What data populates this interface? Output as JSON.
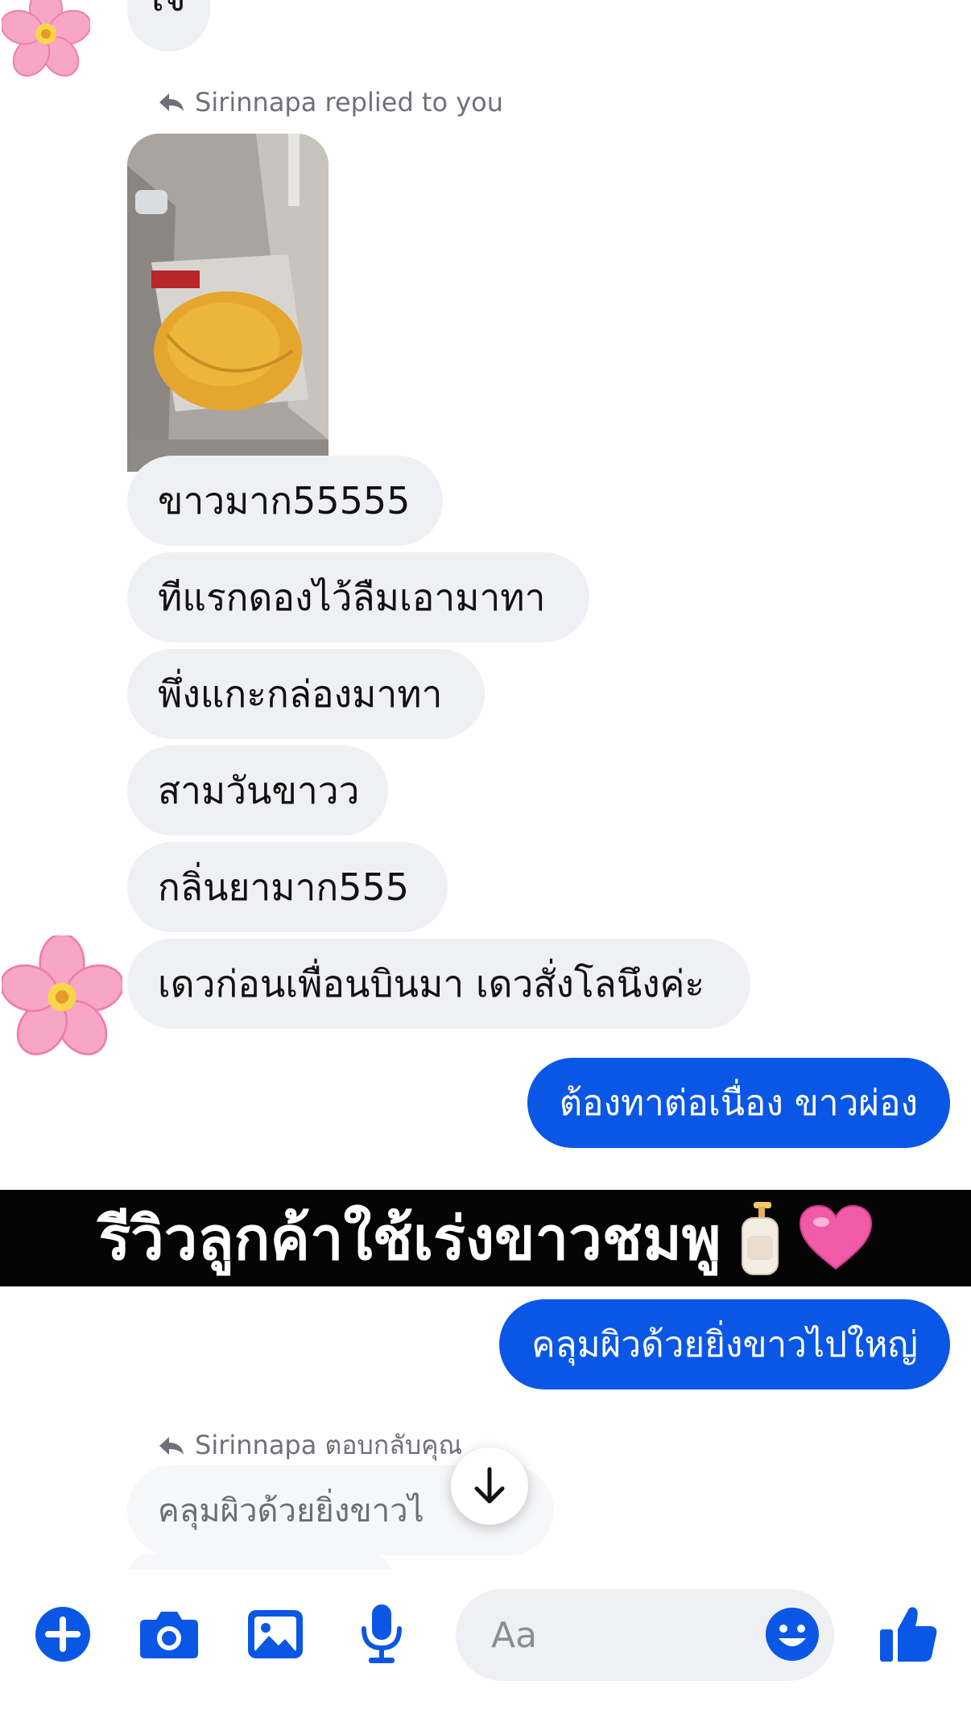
{
  "conversation": {
    "top_partial_message": "เจ",
    "reply_label_1": "Sirinnapa replied to you",
    "messages_in": [
      "ขาวมาก55555",
      "ทีแรกดองไว้ลืมเอามาทา",
      "พึ่งแกะกล่องมาทา",
      "สามวันขาวว",
      "กลิ่นยามาก555",
      "เดวก่อนเพื่อนบินมา เดวสั่งโลนึงค่ะ"
    ],
    "message_out_1": "ต้องทาต่อเนื่อง ขาวผ่อง",
    "message_out_2": "คลุมผิวด้วยยิ่งขาวไปใหญ่",
    "reply_label_2": "Sirinnapa ตอบกลับคุณ",
    "quoted_reply_partial": "คลุมผิวด้วยยิ่งขาวไ"
  },
  "overlay_banner": {
    "text": "รีวิวลูกค้าใช้เร่งขาวชมพู",
    "icons": [
      "lotion-bottle-icon",
      "pink-heart-icon"
    ]
  },
  "composer": {
    "placeholder": "Aa",
    "icons": [
      "plus-icon",
      "camera-icon",
      "image-icon",
      "microphone-icon",
      "emoji-icon",
      "thumbs-up-icon"
    ]
  },
  "colors": {
    "accent": "#0a57e6",
    "incoming_bubble": "#eff0f3",
    "banner_bg": "#050505"
  }
}
